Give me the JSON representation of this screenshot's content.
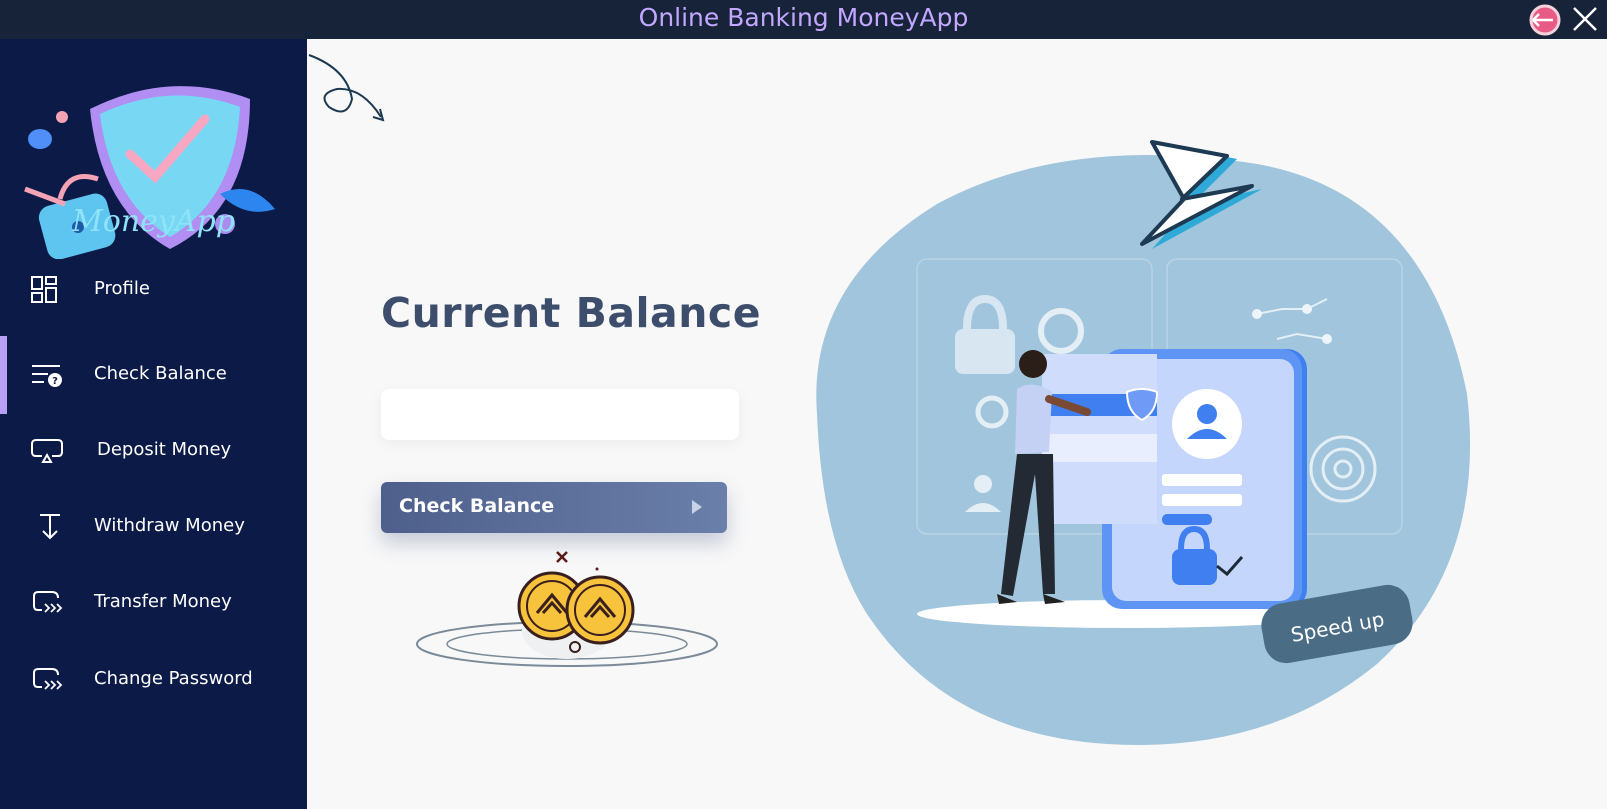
{
  "window": {
    "title": "Online Banking MoneyApp"
  },
  "sidebar": {
    "brand": "MoneyApp",
    "items": [
      {
        "label": "Profile",
        "icon": "dashboard-icon"
      },
      {
        "label": "Check Balance",
        "icon": "list-question-icon",
        "active": true
      },
      {
        "label": "Deposit Money",
        "icon": "deposit-icon"
      },
      {
        "label": "Withdraw Money",
        "icon": "withdraw-arrow-icon"
      },
      {
        "label": "Transfer Money",
        "icon": "transfer-icon"
      },
      {
        "label": "Change Password",
        "icon": "password-icon"
      }
    ]
  },
  "main": {
    "heading": "Current Balance",
    "balance_value": "",
    "check_button": "Check Balance",
    "illustration_badge": "Speed up"
  },
  "colors": {
    "titlebar": "#162339",
    "title_text": "#c2a6ff",
    "sidebar": "#0c1a47",
    "active_indicator": "#b8a0f6",
    "heading": "#3d4e6c",
    "button": "#5a6b96",
    "blob": "#9ec3db"
  }
}
